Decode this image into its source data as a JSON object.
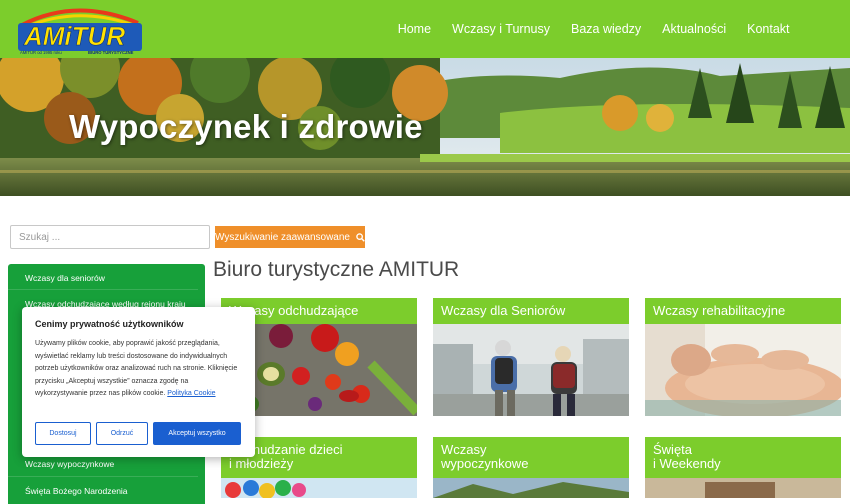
{
  "logo": {
    "main": "AMITUR",
    "tagline_left": "AMITUR od 1995 roku",
    "tagline_right": "BIURO TURYSTYCZNE"
  },
  "nav": {
    "items": [
      {
        "label": "Home"
      },
      {
        "label": "Wczasy i Turnusy"
      },
      {
        "label": "Baza wiedzy"
      },
      {
        "label": "Aktualności"
      },
      {
        "label": "Kontakt"
      }
    ]
  },
  "hero": {
    "title": "Wypoczynek i zdrowie"
  },
  "search": {
    "placeholder": "Szukaj ...",
    "advanced_label": "Wyszukiwanie zaawansowane"
  },
  "main": {
    "title": "Biuro turystyczne AMITUR"
  },
  "sidebar": {
    "items": [
      {
        "label": "Wczasy dla seniorów"
      },
      {
        "label": "Wczasy odchudzające według rejonu kraju"
      },
      {
        "label": "Wczasy wypoczynkowe"
      },
      {
        "label": "Święta Bożego Narodzenia"
      }
    ]
  },
  "cards": [
    {
      "title": "Wczasy odchudzające"
    },
    {
      "title": "Wczasy dla Seniorów"
    },
    {
      "title": "Wczasy rehabilitacyjne"
    },
    {
      "title_line1": "Odchudzanie dzieci",
      "title_line2": "i młodzieży"
    },
    {
      "title_line1": "Wczasy",
      "title_line2": "wypoczynkowe"
    },
    {
      "title_line1": "Święta",
      "title_line2": "i Weekendy"
    }
  ],
  "cookie": {
    "title": "Cenimy prywatność użytkowników",
    "text": "Używamy plików cookie, aby poprawić jakość przeglądania, wyświetlać reklamy lub treści dostosowane do indywidualnych potrzeb użytkowników oraz analizować ruch na stronie. Kliknięcie przycisku „Akceptuj wszystkie” oznacza zgodę na wykorzystywanie przez nas plików cookie.",
    "link": "Polityka Cookie",
    "btn_customize": "Dostosuj",
    "btn_reject": "Odrzuć",
    "btn_accept": "Akceptuj wszystko"
  },
  "colors": {
    "brand_green": "#7ccd2c",
    "sidebar_green": "#17a03a",
    "accent_orange": "#ef8f2a",
    "cookie_blue": "#1a5fd0"
  }
}
